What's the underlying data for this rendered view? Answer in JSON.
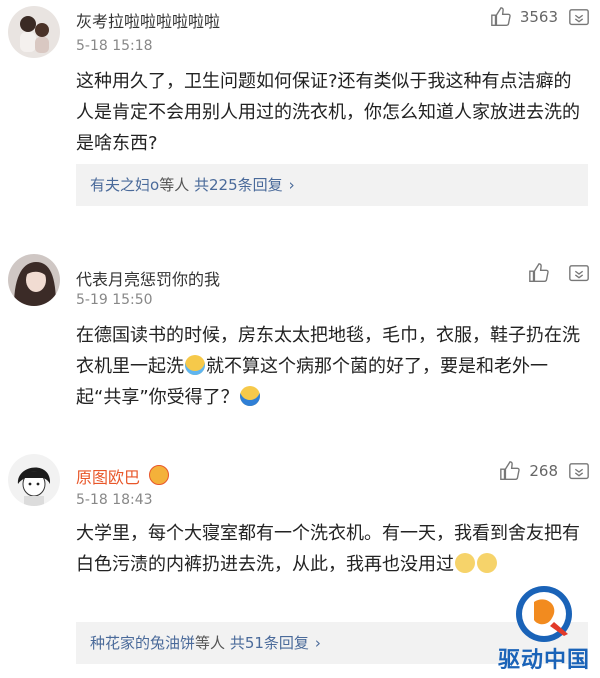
{
  "comments": [
    {
      "username": "灰考拉啦啦啦啦啦啦",
      "time": "5-18 15:18",
      "likes": "3563",
      "text": "这种用久了，卫生问题如何保证?还有类似于我这种有点洁癖的人是肯定不会用别人用过的洗衣机，你怎么知道人家放进去洗的是啥东西?",
      "replies": {
        "name": "有夫之妇o",
        "rest": "等人",
        "count": "共225条回复",
        "chevron": "›"
      }
    },
    {
      "username": "代表月亮惩罚你的我",
      "time": "5-19 15:50",
      "likes": "",
      "text_parts": [
        "在德国读书的时候，房东太太把地毯，毛巾，衣服，鞋子扔在洗衣机里一起洗",
        "就不算这个病那个菌的好了，要是和老外一起“共享”你受得了？"
      ],
      "emojis": [
        "crying-emoji",
        "shrug-emoji"
      ]
    },
    {
      "username": "原图欧巴",
      "time": "5-18 18:43",
      "likes": "268",
      "text": "大学里，每个大寝室都有一个洗衣机。有一天，我看到舍友把有白色污渍的内裤扔进去洗，从此，我再也没用过",
      "replies": {
        "name": "种花家的兔油饼",
        "rest": "等人",
        "count": "共51条回复",
        "chevron": "›"
      }
    }
  ],
  "watermark": {
    "text": "驱动中国"
  },
  "colors": {
    "link": "#4a6a9a",
    "vip_name": "#e8572a",
    "reply_bg": "#f2f2f2",
    "watermark": "#1a63b8"
  }
}
